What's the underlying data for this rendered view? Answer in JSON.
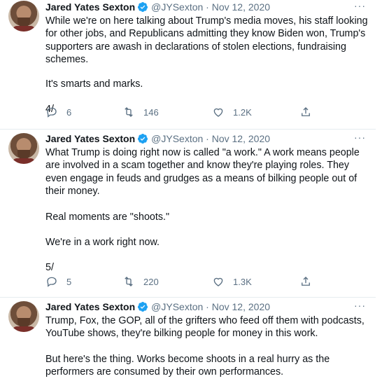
{
  "tweets": [
    {
      "name": "Jared Yates Sexton",
      "handle_date": "@JYSexton · Nov 12, 2020",
      "more": "···",
      "paragraphs": [
        "While we're on here talking about Trump's media moves, his staff looking for other jobs, and Republicans admitting they know Biden won, Trump's supporters are awash in declarations of stolen elections, fundraising schemes.",
        "It's smarts and marks.",
        "4/"
      ],
      "replies": "6",
      "retweets": "146",
      "likes": "1.2K"
    },
    {
      "name": "Jared Yates Sexton",
      "handle_date": "@JYSexton · Nov 12, 2020",
      "more": "···",
      "paragraphs": [
        "What Trump is doing right now is called \"a work.\" A work means people are involved in a scam together and know they're playing roles. They even engage in feuds and grudges as a means of bilking people out of their money.",
        "Real moments are \"shoots.\"",
        "We're in a work right now.",
        "5/"
      ],
      "replies": "5",
      "retweets": "220",
      "likes": "1.3K"
    },
    {
      "name": "Jared Yates Sexton",
      "handle_date": "@JYSexton · Nov 12, 2020",
      "more": "···",
      "paragraphs": [
        "Trump, Fox, the GOP, all of the grifters who feed off them with podcasts, YouTube shows, they're bilking people for money in this work.",
        "But here's the thing. Works become shoots in a real hurry as the performers are consumed by their own performances."
      ]
    }
  ],
  "colors": {
    "verified": "#1da1f2",
    "muted": "#5b7083",
    "text": "#0f1419"
  }
}
